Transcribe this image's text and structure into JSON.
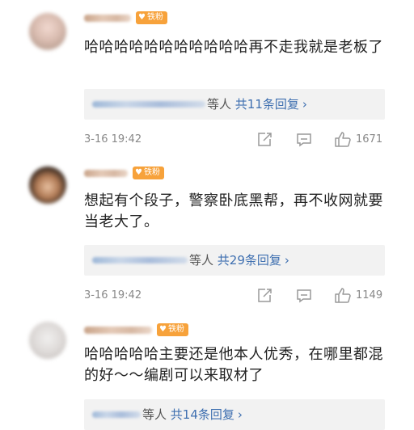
{
  "badge_label": "铁粉",
  "comments": [
    {
      "text": "哈哈哈哈哈哈哈哈哈哈哈再不走我就是老板了",
      "reply_suffix": "等人",
      "reply_count": "共11条回复",
      "time": "3-16 19:42",
      "likes": "1671"
    },
    {
      "text": "想起有个段子，警察卧底黑帮，再不收网就要当老大了。",
      "reply_suffix": "等人",
      "reply_count": "共29条回复",
      "time": "3-16 19:42",
      "likes": "1149"
    },
    {
      "text": "哈哈哈哈哈主要还是他本人优秀，在哪里都混的好～～编剧可以来取材了",
      "reply_suffix": "等人",
      "reply_count": "共14条回复"
    }
  ],
  "reply_chevron": "›",
  "icons": [
    "share-icon",
    "comment-icon",
    "like-icon",
    "heart-icon"
  ],
  "colors": {
    "badge": "#f7a23b",
    "link": "#3e6fb0",
    "reply_bg": "#f2f2f2"
  }
}
